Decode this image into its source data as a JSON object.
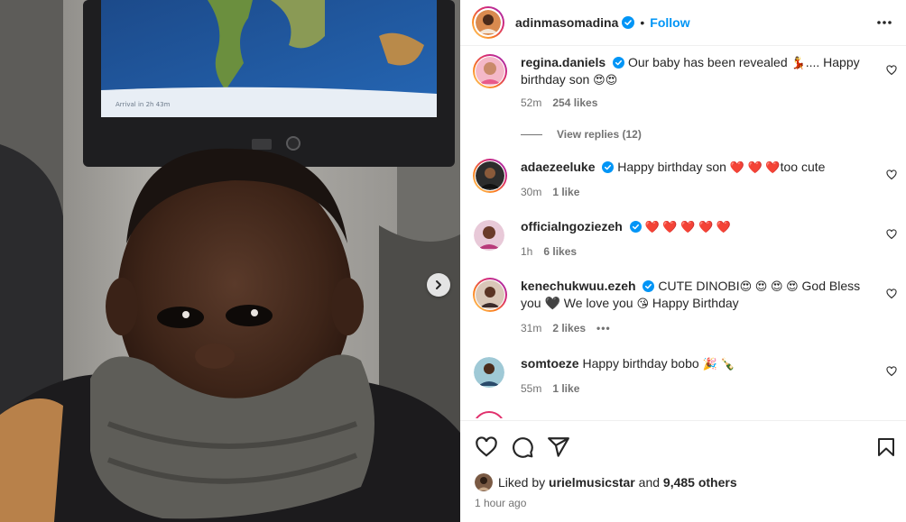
{
  "post": {
    "author": "adinmasomadina",
    "follow_label": "Follow",
    "separator": "•",
    "time_ago": "1 hour ago",
    "liked_by_prefix": "Liked by",
    "liked_by_user": "urielmusicstar",
    "liked_by_and": "and",
    "liked_by_others": "9,485 others"
  },
  "comments": [
    {
      "username": "regina.daniels",
      "verified": true,
      "text": "Our baby has been revealed",
      "text2": ".... Happy birthday son",
      "time": "52m",
      "likes": "254 likes",
      "view_replies": "View replies (12)"
    },
    {
      "username": "adaezeeluke",
      "verified": true,
      "text": "Happy birthday son",
      "text2": "too cute",
      "time": "30m",
      "likes": "1 like"
    },
    {
      "username": "officialngoziezeh",
      "verified": true,
      "text": "",
      "time": "1h",
      "likes": "6 likes"
    },
    {
      "username": "kenechukwuu.ezeh",
      "verified": true,
      "text": "CUTE DINOBI",
      "text2": "God Bless you",
      "text3": "We love you",
      "text4": "Happy Birthday",
      "time": "31m",
      "likes": "2 likes",
      "more": "•••"
    },
    {
      "username": "somtoeze",
      "verified": false,
      "text": "Happy birthday bobo",
      "time": "55m",
      "likes": "1 like"
    }
  ],
  "photo": {
    "screen_text": "Arrival in 2h 43m"
  },
  "icons": {
    "verified": "verified-badge-icon",
    "more": "more-horizontal-icon",
    "heart": "heart-icon",
    "comment": "comment-icon",
    "share": "share-icon",
    "save": "bookmark-icon",
    "next": "chevron-right-icon"
  },
  "colors": {
    "accent": "#0095f6",
    "verified": "#0095f6",
    "meta": "#737373",
    "heart_emoji": "#ed1c24"
  }
}
